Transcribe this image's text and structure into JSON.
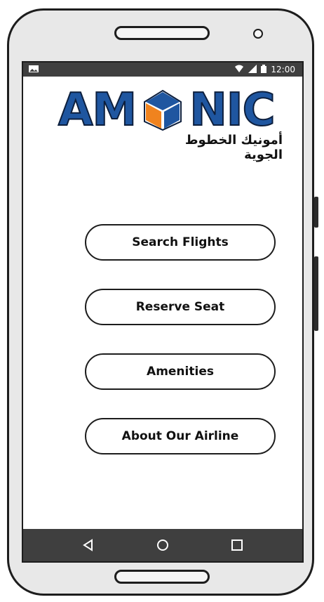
{
  "status_bar": {
    "time": "12:00",
    "icons": [
      "image-icon",
      "wifi-icon",
      "signal-icon",
      "battery-icon"
    ]
  },
  "logo": {
    "brand_left": "AM",
    "brand_right": "NIC",
    "arabic_tagline": "أمونيك الخطوط الجوية",
    "colors": {
      "brand_blue": "#1f56a0",
      "brand_orange": "#f0831e"
    }
  },
  "menu": {
    "items": [
      {
        "label": "Search Flights"
      },
      {
        "label": "Reserve Seat"
      },
      {
        "label": "Amenities"
      },
      {
        "label": "About Our Airline"
      }
    ]
  },
  "nav_bar": {
    "icons": [
      "back-icon",
      "home-icon",
      "recent-apps-icon"
    ]
  }
}
